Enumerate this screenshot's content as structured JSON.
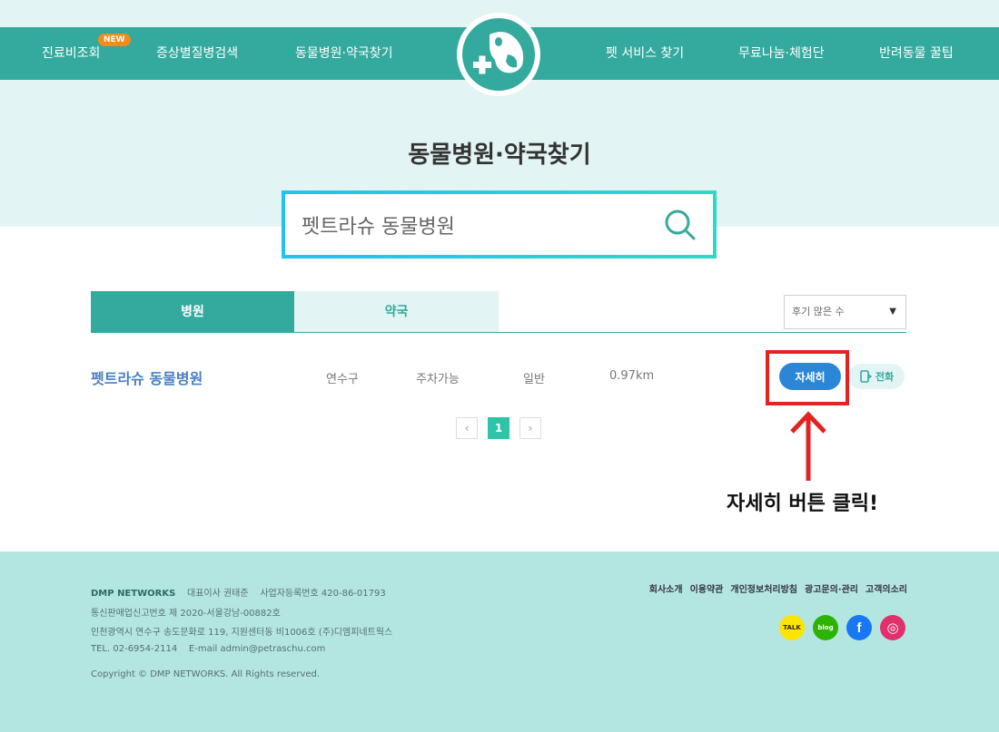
{
  "nav": {
    "items": [
      "진료비조회",
      "증상별질병검색",
      "동물병원·약국찾기",
      "펫 서비스 찾기",
      "무료나눔·체험단",
      "반려동물 꿀팁"
    ],
    "new_badge": "NEW"
  },
  "page_title": "동물병원·약국찾기",
  "search": {
    "value": "펫트라슈 동물병원"
  },
  "tabs": [
    "병원",
    "약국"
  ],
  "sort": {
    "selected": "후기 많은 수"
  },
  "results": [
    {
      "name": "펫트라슈 동물병원",
      "district": "연수구",
      "parking": "주차가능",
      "type": "일반",
      "distance": "0.97km",
      "detail_label": "자세히",
      "call_label": "전화"
    }
  ],
  "pagination": {
    "prev": "‹",
    "current": "1",
    "next": "›"
  },
  "annotation": "자세히 버튼 클릭!",
  "footer": {
    "company": "DMP NETWORKS",
    "ceo": "대표이사 권태준",
    "biz_no": "사업자등록번호 420-86-01793",
    "telecom": "통신판매업신고번호 제 2020-서울강남-00882호",
    "address": "인천광역시 연수구 송도문화로 119, 지원센터동 비1006호 (주)디엠피네트웍스",
    "contact": "TEL. 02-6954-2114    E-mail admin@petraschu.com",
    "copyright": "Copyright © DMP NETWORKS. All Rights reserved.",
    "links": [
      "회사소개",
      "이용약관",
      "개인정보처리방침",
      "광고문의·관리",
      "고객의소리"
    ],
    "social": {
      "talk": "TALK",
      "blog": "blog",
      "facebook": "f",
      "instagram": "◎"
    }
  },
  "colors": {
    "brand": "#34a99d",
    "light": "#e2f4f3",
    "footer": "#b4e6e1",
    "button_blue": "#2b86d8",
    "highlight": "#e42222"
  }
}
